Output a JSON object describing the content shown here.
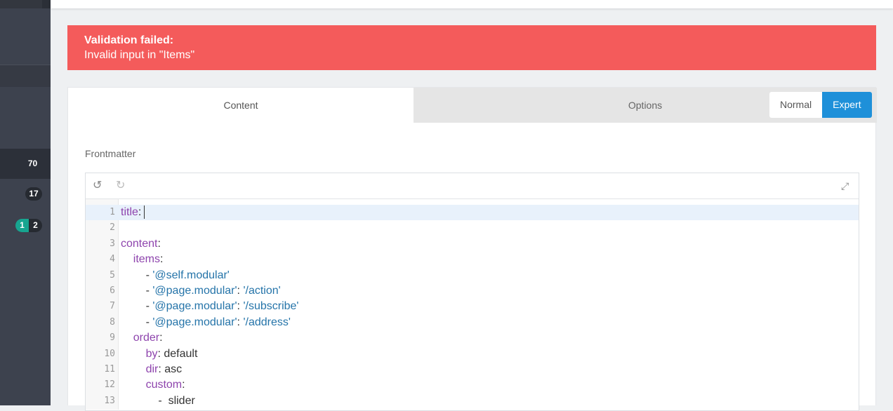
{
  "sidebar": {
    "badges": {
      "count_a": "70",
      "count_b": "17",
      "count_c_new": "1",
      "count_c_total": "2"
    }
  },
  "alert": {
    "title": "Validation failed:",
    "message": "Invalid input in \"Items\""
  },
  "tabs": [
    {
      "label": "Content",
      "active": true
    },
    {
      "label": "Options",
      "active": false
    }
  ],
  "mode_toggle": {
    "normal_label": "Normal",
    "expert_label": "Expert",
    "selected": "Expert"
  },
  "editor": {
    "label": "Frontmatter",
    "lines": [
      {
        "n": "1",
        "indent": "",
        "parts": [
          {
            "t": "title",
            "c": "k"
          },
          {
            "t": ":",
            "c": "p"
          }
        ]
      },
      {
        "n": "2",
        "indent": "",
        "parts": []
      },
      {
        "n": "3",
        "indent": "",
        "parts": [
          {
            "t": "content",
            "c": "k"
          },
          {
            "t": ":",
            "c": "p"
          }
        ]
      },
      {
        "n": "4",
        "indent": "    ",
        "parts": [
          {
            "t": "items",
            "c": "k"
          },
          {
            "t": ":",
            "c": "p"
          }
        ]
      },
      {
        "n": "5",
        "indent": "        ",
        "parts": [
          {
            "t": "- ",
            "c": "p"
          },
          {
            "t": "'@self.modular'",
            "c": "s"
          }
        ]
      },
      {
        "n": "6",
        "indent": "        ",
        "parts": [
          {
            "t": "- ",
            "c": "p"
          },
          {
            "t": "'@page.modular'",
            "c": "s"
          },
          {
            "t": ": ",
            "c": "p"
          },
          {
            "t": "'/action'",
            "c": "s"
          }
        ]
      },
      {
        "n": "7",
        "indent": "        ",
        "parts": [
          {
            "t": "- ",
            "c": "p"
          },
          {
            "t": "'@page.modular'",
            "c": "s"
          },
          {
            "t": ": ",
            "c": "p"
          },
          {
            "t": "'/subscribe'",
            "c": "s"
          }
        ]
      },
      {
        "n": "8",
        "indent": "        ",
        "parts": [
          {
            "t": "- ",
            "c": "p"
          },
          {
            "t": "'@page.modular'",
            "c": "s"
          },
          {
            "t": ": ",
            "c": "p"
          },
          {
            "t": "'/address'",
            "c": "s"
          }
        ]
      },
      {
        "n": "9",
        "indent": "    ",
        "parts": [
          {
            "t": "order",
            "c": "k"
          },
          {
            "t": ":",
            "c": "p"
          }
        ]
      },
      {
        "n": "10",
        "indent": "        ",
        "parts": [
          {
            "t": "by",
            "c": "k"
          },
          {
            "t": ": default",
            "c": "p"
          }
        ]
      },
      {
        "n": "11",
        "indent": "        ",
        "parts": [
          {
            "t": "dir",
            "c": "k"
          },
          {
            "t": ": asc",
            "c": "p"
          }
        ]
      },
      {
        "n": "12",
        "indent": "        ",
        "parts": [
          {
            "t": "custom",
            "c": "k"
          },
          {
            "t": ":",
            "c": "p"
          }
        ]
      },
      {
        "n": "13",
        "indent": "            ",
        "parts": [
          {
            "t": "-  slider",
            "c": "p"
          }
        ]
      }
    ]
  },
  "icons": {
    "undo": "undo-icon",
    "redo": "redo-icon",
    "expand": "expand-icon"
  },
  "colors": {
    "alert": "#f45b5b",
    "expert": "#1e90d9",
    "key": "#8e44ad",
    "string": "#2574a9",
    "badge_new": "#17a590"
  }
}
